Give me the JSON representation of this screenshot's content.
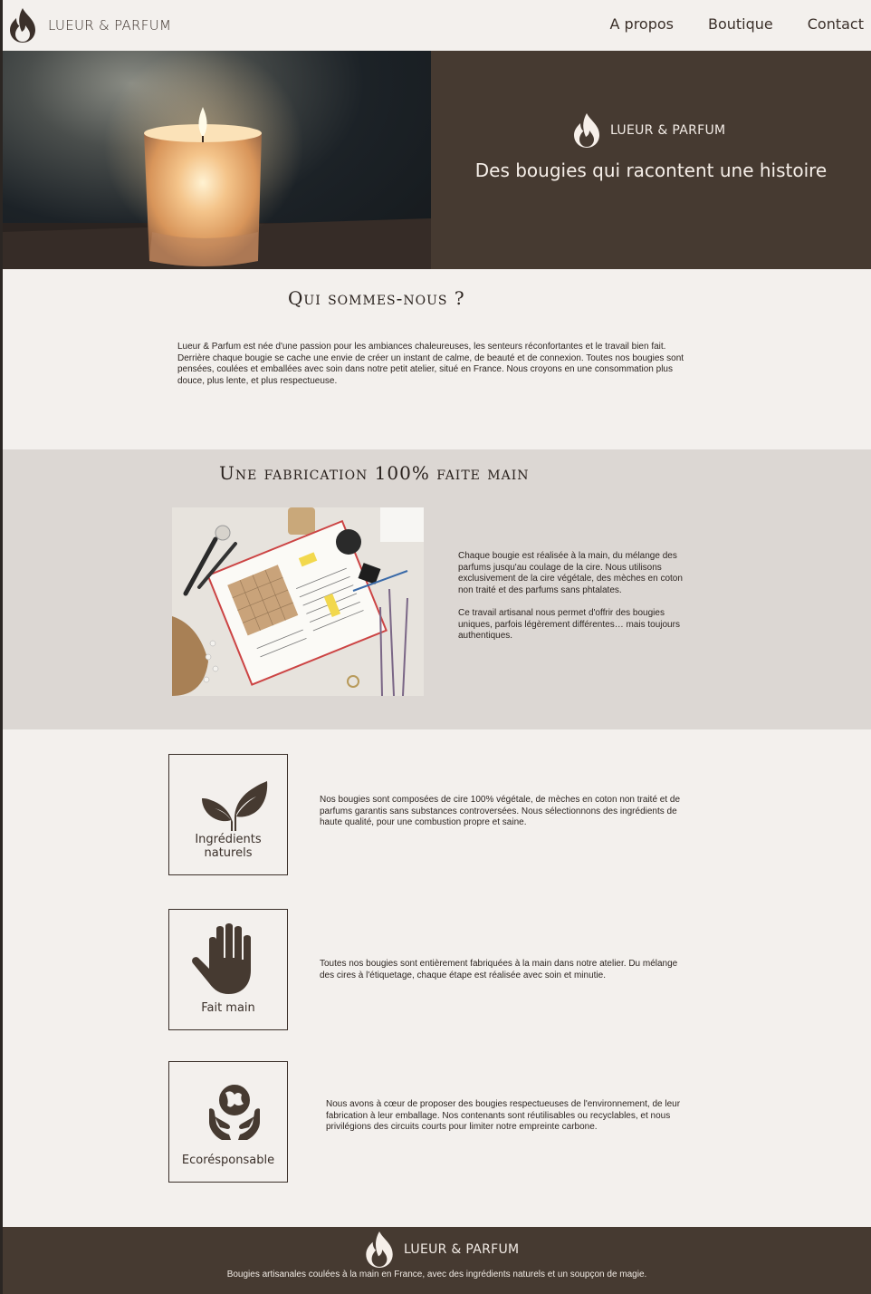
{
  "header": {
    "brand": "LUEUR & PARFUM",
    "logo_icon": "flame-icon",
    "nav": [
      "A propos",
      "Boutique",
      "Contact"
    ]
  },
  "hero": {
    "brand": "LUEUR & PARFUM",
    "tagline": "Des bougies qui racontent une histoire"
  },
  "about": {
    "title": "Qui sommes-nous ?",
    "text": "Lueur & Parfum est née d'une passion pour les ambiances chaleureuses, les senteurs réconfortantes et le travail bien fait. Derrière chaque bougie se cache une envie de créer un instant de calme, de beauté et de connexion. Toutes nos bougies sont pensées, coulées et emballées avec soin dans notre petit atelier, situé en France. Nous croyons en une consommation plus douce, plus lente, et plus respectueuse."
  },
  "fabrication": {
    "title": "Une fabrication 100% faite main",
    "paragraph1": "Chaque bougie est réalisée à la main, du mélange des parfums jusqu'au coulage de la cire. Nous utilisons exclusivement de la cire végétale, des mèches en coton non traité et des parfums sans phtalates.",
    "paragraph2": "Ce travail artisanal nous permet d'offrir des bougies uniques, parfois légèrement différentes… mais toujours authentiques."
  },
  "features": [
    {
      "icon": "plant-sprout-icon",
      "label": "Ingrédients naturels",
      "text": "Nos bougies sont composées de cire 100% végétale, de mèches en coton non traité et de parfums garantis sans substances controversées. Nous sélectionnons des ingrédients de haute qualité, pour une combustion propre et saine."
    },
    {
      "icon": "hand-icon",
      "label": "Fait main",
      "text": "Toutes nos bougies sont entièrement fabriquées à la main dans notre atelier. Du mélange des cires à l'étiquetage, chaque étape est réalisée avec soin et minutie."
    },
    {
      "icon": "hands-globe-icon",
      "label": "Ecorésponsable",
      "text": "Nous avons à cœur de proposer des bougies respectueuses de l'environnement, de leur fabrication à leur emballage. Nos contenants sont réutilisables ou recyclables, et nous privilégions des circuits courts pour limiter notre empreinte carbone."
    }
  ],
  "footer": {
    "brand": "LUEUR & PARFUM",
    "text": "Bougies artisanales coulées à la main en France, avec des ingrédients naturels et un soupçon de magie."
  },
  "colors": {
    "background": "#f3f0ed",
    "brown": "#463a31",
    "section_grey": "#dcd7d3",
    "text_dark": "#2a221e"
  }
}
